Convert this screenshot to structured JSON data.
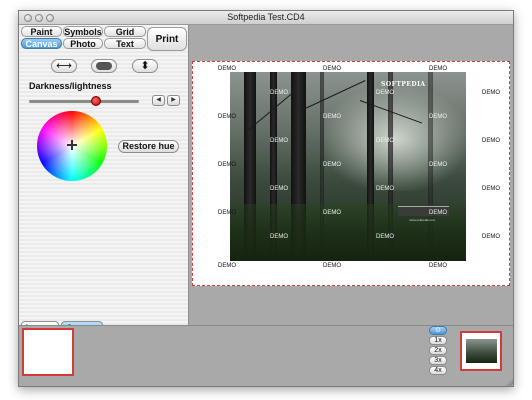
{
  "window": {
    "title": "Softpedia Test.CD4"
  },
  "tabs": {
    "row1": [
      "Paint",
      "Symbols",
      "Grid"
    ],
    "row2": [
      "Canvas",
      "Photo",
      "Text"
    ],
    "selected": "Canvas",
    "print_label": "Print"
  },
  "tools": {
    "fit_width_icon": "⟷",
    "toggle_icon": "toggle-switch",
    "fit_height_icon": "⬍"
  },
  "color": {
    "darkness_label": "Darkness/lightness",
    "darkness_value": 0.61,
    "restore_hue_label": "Restore hue",
    "decrease_arrow": "◀",
    "increase_arrow": "▶",
    "selected_color": "#ffffff"
  },
  "bottom_tabs": {
    "layers": "Layers",
    "canvas": "Canvas",
    "selected": "Canvas"
  },
  "canvas": {
    "watermark": "DEMO",
    "photo_logo": "SOFTPEDIA",
    "photo_caption": "www.softpedia.com"
  },
  "zoom": {
    "current_icon": "⊙",
    "levels": [
      "1x",
      "2x",
      "3x",
      "4x"
    ]
  },
  "colors": {
    "accent_blue": "#4c99d8",
    "page_border": "#d43a3a",
    "canvas_bg": "#a9a9a9"
  }
}
